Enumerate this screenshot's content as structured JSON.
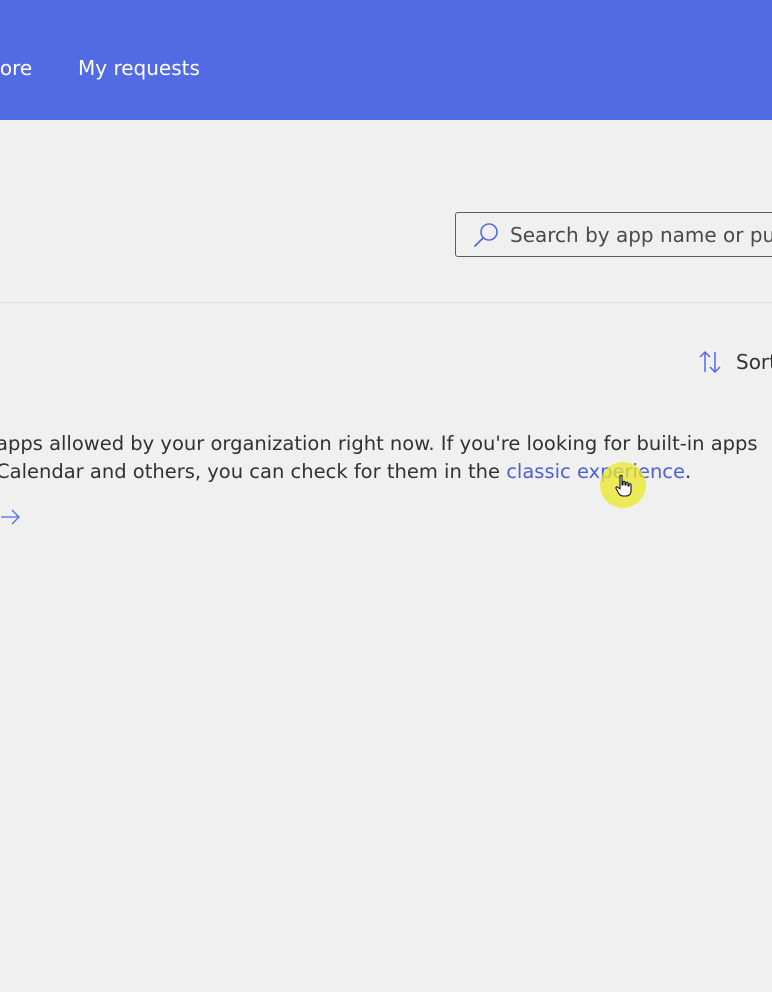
{
  "header": {
    "nav_items": [
      {
        "label": "tore"
      },
      {
        "label": "My requests"
      }
    ],
    "background_color": "#536be2"
  },
  "search": {
    "placeholder": "Search by app name or publ",
    "icon": "search-icon"
  },
  "sort": {
    "label": "Sort",
    "icon": "sort-icon"
  },
  "message": {
    "line1": " apps allowed by your organization right now. If you're looking for built-in apps",
    "line2_prefix": "Calendar and others, you can check for them in the ",
    "link_text": "classic experience",
    "line2_suffix": "."
  },
  "arrow_link": {
    "icon": "arrow-right-icon"
  },
  "colors": {
    "accent": "#536be2",
    "link": "#4f5fd6",
    "text": "#323232",
    "background": "#f0f0f0"
  }
}
